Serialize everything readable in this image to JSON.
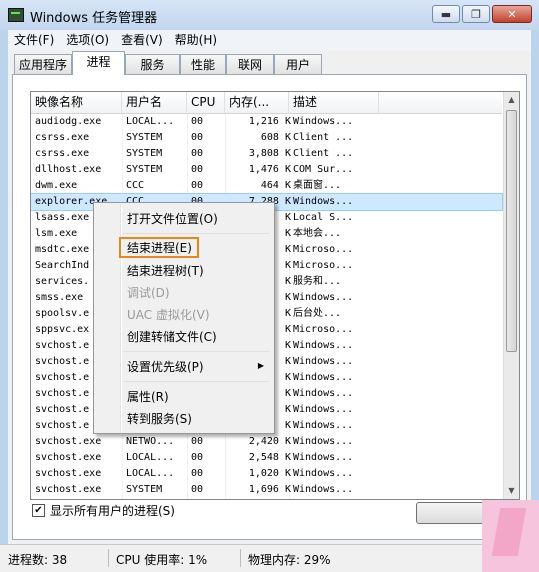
{
  "window": {
    "title": "Windows 任务管理器"
  },
  "caption_buttons": {
    "minimize": "▬",
    "maximize": "❐",
    "close": "✕"
  },
  "menu": [
    "文件(F)",
    "选项(O)",
    "查看(V)",
    "帮助(H)"
  ],
  "tabs": [
    "应用程序",
    "进程",
    "服务",
    "性能",
    "联网",
    "用户"
  ],
  "active_tab": "进程",
  "columns": [
    "映像名称",
    "用户名",
    "CPU",
    "内存(...",
    "描述"
  ],
  "processes": [
    {
      "name": "audiodg.exe",
      "user": "LOCAL...",
      "cpu": "00",
      "mem": "1,216 K",
      "desc": "Windows..."
    },
    {
      "name": "csrss.exe",
      "user": "SYSTEM",
      "cpu": "00",
      "mem": "608 K",
      "desc": "Client ..."
    },
    {
      "name": "csrss.exe",
      "user": "SYSTEM",
      "cpu": "00",
      "mem": "3,808 K",
      "desc": "Client ..."
    },
    {
      "name": "dllhost.exe",
      "user": "SYSTEM",
      "cpu": "00",
      "mem": "1,476 K",
      "desc": "COM Sur..."
    },
    {
      "name": "dwm.exe",
      "user": "CCC",
      "cpu": "00",
      "mem": "464 K",
      "desc": "桌面窗..."
    },
    {
      "name": "explorer.exe",
      "user": "CCC",
      "cpu": "00",
      "mem": "7,288 K",
      "desc": "Windows..."
    },
    {
      "name": "lsass.exe",
      "user": "",
      "cpu": "",
      "mem": "K",
      "desc": "Local S..."
    },
    {
      "name": "lsm.exe",
      "user": "",
      "cpu": "",
      "mem": "K",
      "desc": "本地会..."
    },
    {
      "name": "msdtc.exe",
      "user": "",
      "cpu": "",
      "mem": "K",
      "desc": "Microso..."
    },
    {
      "name": "SearchInd",
      "user": "",
      "cpu": "",
      "mem": "K",
      "desc": "Microso..."
    },
    {
      "name": "services.",
      "user": "",
      "cpu": "",
      "mem": "K",
      "desc": "服务和..."
    },
    {
      "name": "smss.exe",
      "user": "",
      "cpu": "",
      "mem": "K",
      "desc": "Windows..."
    },
    {
      "name": "spoolsv.e",
      "user": "",
      "cpu": "",
      "mem": "K",
      "desc": "后台处..."
    },
    {
      "name": "sppsvc.ex",
      "user": "",
      "cpu": "",
      "mem": "K",
      "desc": "Microso..."
    },
    {
      "name": "svchost.e",
      "user": "",
      "cpu": "",
      "mem": "K",
      "desc": "Windows..."
    },
    {
      "name": "svchost.e",
      "user": "",
      "cpu": "",
      "mem": "K",
      "desc": "Windows..."
    },
    {
      "name": "svchost.e",
      "user": "",
      "cpu": "",
      "mem": "K",
      "desc": "Windows..."
    },
    {
      "name": "svchost.e",
      "user": "",
      "cpu": "",
      "mem": "K",
      "desc": "Windows..."
    },
    {
      "name": "svchost.e",
      "user": "",
      "cpu": "",
      "mem": "K",
      "desc": "Windows..."
    },
    {
      "name": "svchost.e",
      "user": "",
      "cpu": "",
      "mem": "K",
      "desc": "Windows..."
    },
    {
      "name": "svchost.exe",
      "user": "NETWO...",
      "cpu": "00",
      "mem": "2,420 K",
      "desc": "Windows..."
    },
    {
      "name": "svchost.exe",
      "user": "LOCAL...",
      "cpu": "00",
      "mem": "2,548 K",
      "desc": "Windows..."
    },
    {
      "name": "svchost.exe",
      "user": "LOCAL...",
      "cpu": "00",
      "mem": "1,020 K",
      "desc": "Windows..."
    },
    {
      "name": "svchost.exe",
      "user": "SYSTEM",
      "cpu": "00",
      "mem": "1,696 K",
      "desc": "Windows..."
    }
  ],
  "selected_index": 5,
  "context_menu": {
    "open_location": "打开文件位置(O)",
    "end_process": "结束进程(E)",
    "end_tree": "结束进程树(T)",
    "debug": "调试(D)",
    "uac": "UAC 虚拟化(V)",
    "dump": "创建转储文件(C)",
    "priority": "设置优先级(P)",
    "properties": "属性(R)",
    "goto_service": "转到服务(S)"
  },
  "show_all_label": "显示所有用户的进程(S)",
  "show_all_checked": "✔",
  "status": {
    "processes": "进程数: 38",
    "cpu": "CPU 使用率: 1%",
    "memory": "物理内存: 29%"
  },
  "highlight_color": "#e8861e"
}
